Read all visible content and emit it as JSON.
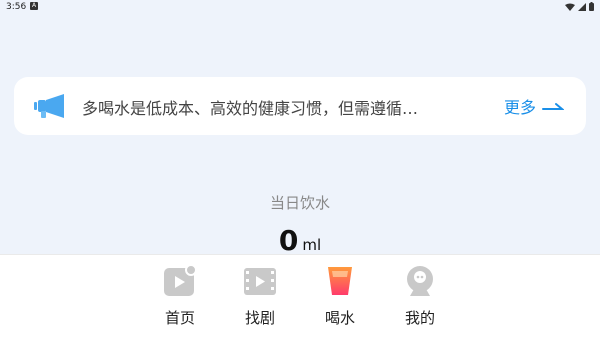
{
  "status_bar": {
    "time": "3:56",
    "notification_badge": "A"
  },
  "notice": {
    "icon": "megaphone-icon",
    "text": "多喝水是低成本、高效的健康习惯，但需遵循…",
    "more_label": "更多"
  },
  "intake": {
    "label": "当日饮水",
    "value": "0",
    "unit": "ml"
  },
  "bottom_nav": {
    "items": [
      {
        "label": "首页",
        "icon": "home-icon"
      },
      {
        "label": "找剧",
        "icon": "film-icon"
      },
      {
        "label": "喝水",
        "icon": "water-cup-icon",
        "active": true
      },
      {
        "label": "我的",
        "icon": "profile-icon"
      }
    ]
  },
  "colors": {
    "accent": "#1a8fe8",
    "background": "#eef3fb",
    "active_gradient_top": "#ff9a3c",
    "active_gradient_bottom": "#ff3b6b",
    "inactive_icon": "#c9c9c9"
  }
}
